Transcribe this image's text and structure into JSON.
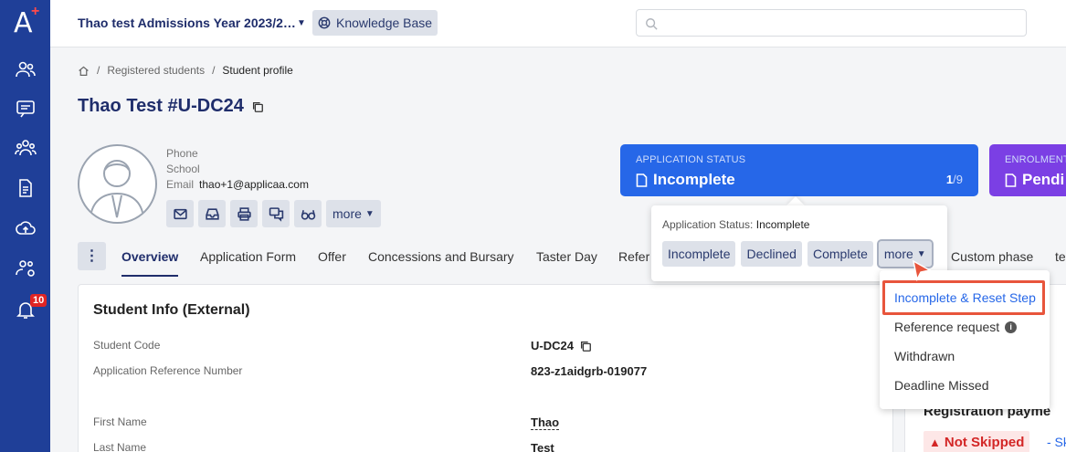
{
  "sidebar": {
    "logo": "A",
    "logo_plus": "+",
    "notification_count": "10"
  },
  "topbar": {
    "program_name": "Thao test Admissions Year 2023/2…",
    "knowledge_base": "Knowledge Base",
    "search_placeholder": ""
  },
  "breadcrumb": {
    "items": [
      "Registered students",
      "Student profile"
    ],
    "sep": "/"
  },
  "student": {
    "title": "Thao Test #U-DC24",
    "phone_label": "Phone",
    "school_label": "School",
    "email_label": "Email",
    "email": "thao+1@applicaa.com",
    "more_label": "more"
  },
  "app_status_card": {
    "label": "APPLICATION STATUS",
    "value": "Incomplete",
    "count_current": "1",
    "count_total": "/9"
  },
  "enrolment_card": {
    "label": "ENROLMENT",
    "value": "Pendi"
  },
  "tabs": [
    "Overview",
    "Application Form",
    "Offer",
    "Concessions and Bursary",
    "Taster Day",
    "Refer",
    "Custom phase",
    "te"
  ],
  "student_info": {
    "title": "Student Info (External)",
    "rows": [
      {
        "label": "Student Code",
        "value": "U-DC24"
      },
      {
        "label": "Application Reference Number",
        "value": "823-z1aidgrb-019077"
      },
      {
        "label": "First Name",
        "value": "Thao"
      },
      {
        "label": "Last Name",
        "value": "Test"
      }
    ]
  },
  "right_panel": {
    "title": "Registration payme",
    "not_skipped": "Not Skipped",
    "skip": "- Ski"
  },
  "status_dropdown": {
    "label": "Application Status:",
    "current": "Incomplete",
    "buttons": [
      "Incomplete",
      "Declined",
      "Complete"
    ],
    "more": "more"
  },
  "more_menu": {
    "items": [
      "Incomplete & Reset Step",
      "Reference request",
      "Withdrawn",
      "Deadline Missed"
    ]
  },
  "colors": {
    "sidebar": "#1f3f98",
    "app_card": "#2667e8",
    "enrol_card": "#7b3fe4",
    "highlight": "#e8553c"
  }
}
